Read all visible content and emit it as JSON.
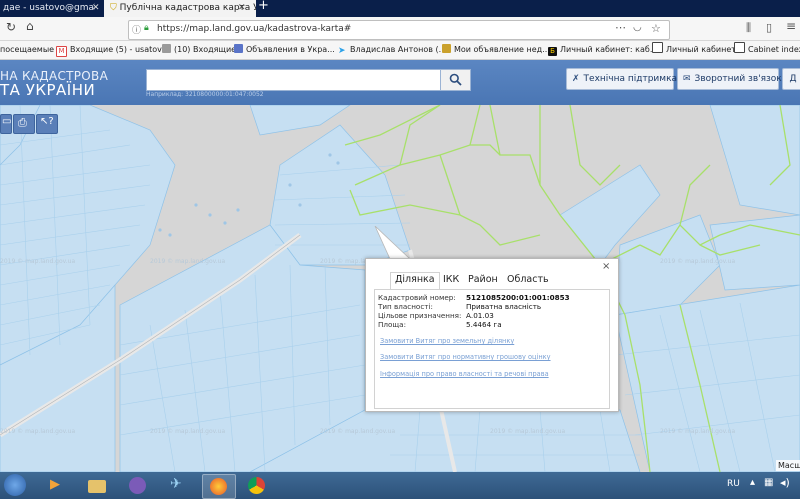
{
  "browser": {
    "tabs": [
      {
        "label": "дае - usatovo@gmail.co"
      },
      {
        "label": "Публічна кадастрова карта Ук"
      }
    ],
    "url": "https://map.land.gov.ua/kadastrova-karta#",
    "bookmarks": [
      {
        "label": "посещаемые",
        "icon": "star-icon"
      },
      {
        "label": "Входящие (5) - usatov...",
        "icon": "gmail-icon"
      },
      {
        "label": "(10) Входящие",
        "icon": "folder-icon"
      },
      {
        "label": "Объявления в Укра...",
        "icon": "ads-icon"
      },
      {
        "label": "Владислав Антонов (...",
        "icon": "twitter-icon"
      },
      {
        "label": "Мои объявление нед...",
        "icon": "home-icon"
      },
      {
        "label": "Личный кабинет: каб...",
        "icon": "b-icon"
      },
      {
        "label": "Личный кабинет",
        "icon": "page-icon"
      },
      {
        "label": "Cabinet index",
        "icon": "page-icon"
      }
    ]
  },
  "app": {
    "title_line1": "НА КАДАСТРОВА",
    "title_line2": "ТА УКРАЇНИ",
    "search_hint": "Наприклад: 3210800000:01:047:0052",
    "tech_support": "Технічна підтримка",
    "feedback": "Зворотний зв'язок",
    "help_label": "Д"
  },
  "popup": {
    "tabs": [
      "Ділянка",
      "ІКК",
      "Район",
      "Область"
    ],
    "active_tab": "Ділянка",
    "fields": [
      {
        "label": "Кадастровий номер:",
        "value": "5121085200:01:001:0853"
      },
      {
        "label": "Тип власності:",
        "value": "Приватна власність"
      },
      {
        "label": "Цільове призначення:",
        "value": "А.01.03"
      },
      {
        "label": "Площа:",
        "value": "5.4464 га"
      }
    ],
    "links": [
      "Замовити Витяг про земельну ділянку",
      "Замовити Витяг про нормативну грошову оцінку",
      "Інформація про право власності та речові права"
    ]
  },
  "map": {
    "scale_label": "Масш"
  },
  "taskbar": {
    "lang": "RU"
  },
  "colors": {
    "map_bg": "#d6d6d6",
    "parcel_fill": "#c6dff2",
    "parcel_stroke": "#8fc2e8",
    "green_boundary": "#a8e06a",
    "header_blue": "#4e7ab8"
  }
}
